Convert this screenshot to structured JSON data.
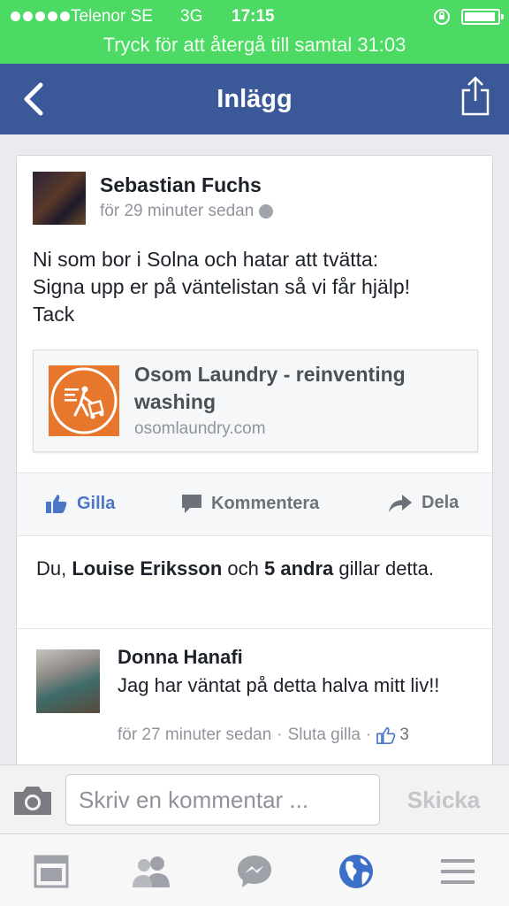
{
  "status_bar": {
    "carrier": "Telenor SE",
    "network": "3G",
    "time": "17:15",
    "call_banner": "Tryck för att återgå till samtal  31:03",
    "bg_color": "#4cd964"
  },
  "nav": {
    "title": "Inlägg",
    "back_icon": "chevron-left-icon",
    "share_icon": "share-icon",
    "bg_color": "#3b5998"
  },
  "post": {
    "author": "Sebastian Fuchs",
    "time": "för 29 minuter sedan",
    "privacy_icon": "globe-icon",
    "text": "Ni som bor i Solna och hatar att tvätta:\nSigna upp er på väntelistan  så vi får hjälp!\nTack",
    "link": {
      "title": "Osom Laundry - reinventing washing",
      "domain": "osomlaundry.com",
      "thumb_color": "#e8772e"
    },
    "actions": {
      "like": "Gilla",
      "comment": "Kommentera",
      "share": "Dela"
    },
    "likes_summary": {
      "prefix": "Du, ",
      "name": "Louise Eriksson",
      "middle": " och ",
      "others": "5 andra",
      "suffix": " gillar detta."
    }
  },
  "comment": {
    "author": "Donna Hanafi",
    "text": "Jag har väntat på detta halva mitt liv!!",
    "time": "för 27 minuter sedan",
    "separator": "·",
    "unlike": "Sluta gilla",
    "like_count": "3"
  },
  "composer": {
    "placeholder": "Skriv en kommentar ...",
    "send": "Skicka"
  },
  "tabs": [
    {
      "icon": "news-feed-icon"
    },
    {
      "icon": "friends-icon"
    },
    {
      "icon": "messenger-icon"
    },
    {
      "icon": "globe-icon"
    },
    {
      "icon": "menu-icon"
    }
  ],
  "colors": {
    "like_blue": "#4a76c8",
    "active_tab": "#3b6fc8"
  }
}
